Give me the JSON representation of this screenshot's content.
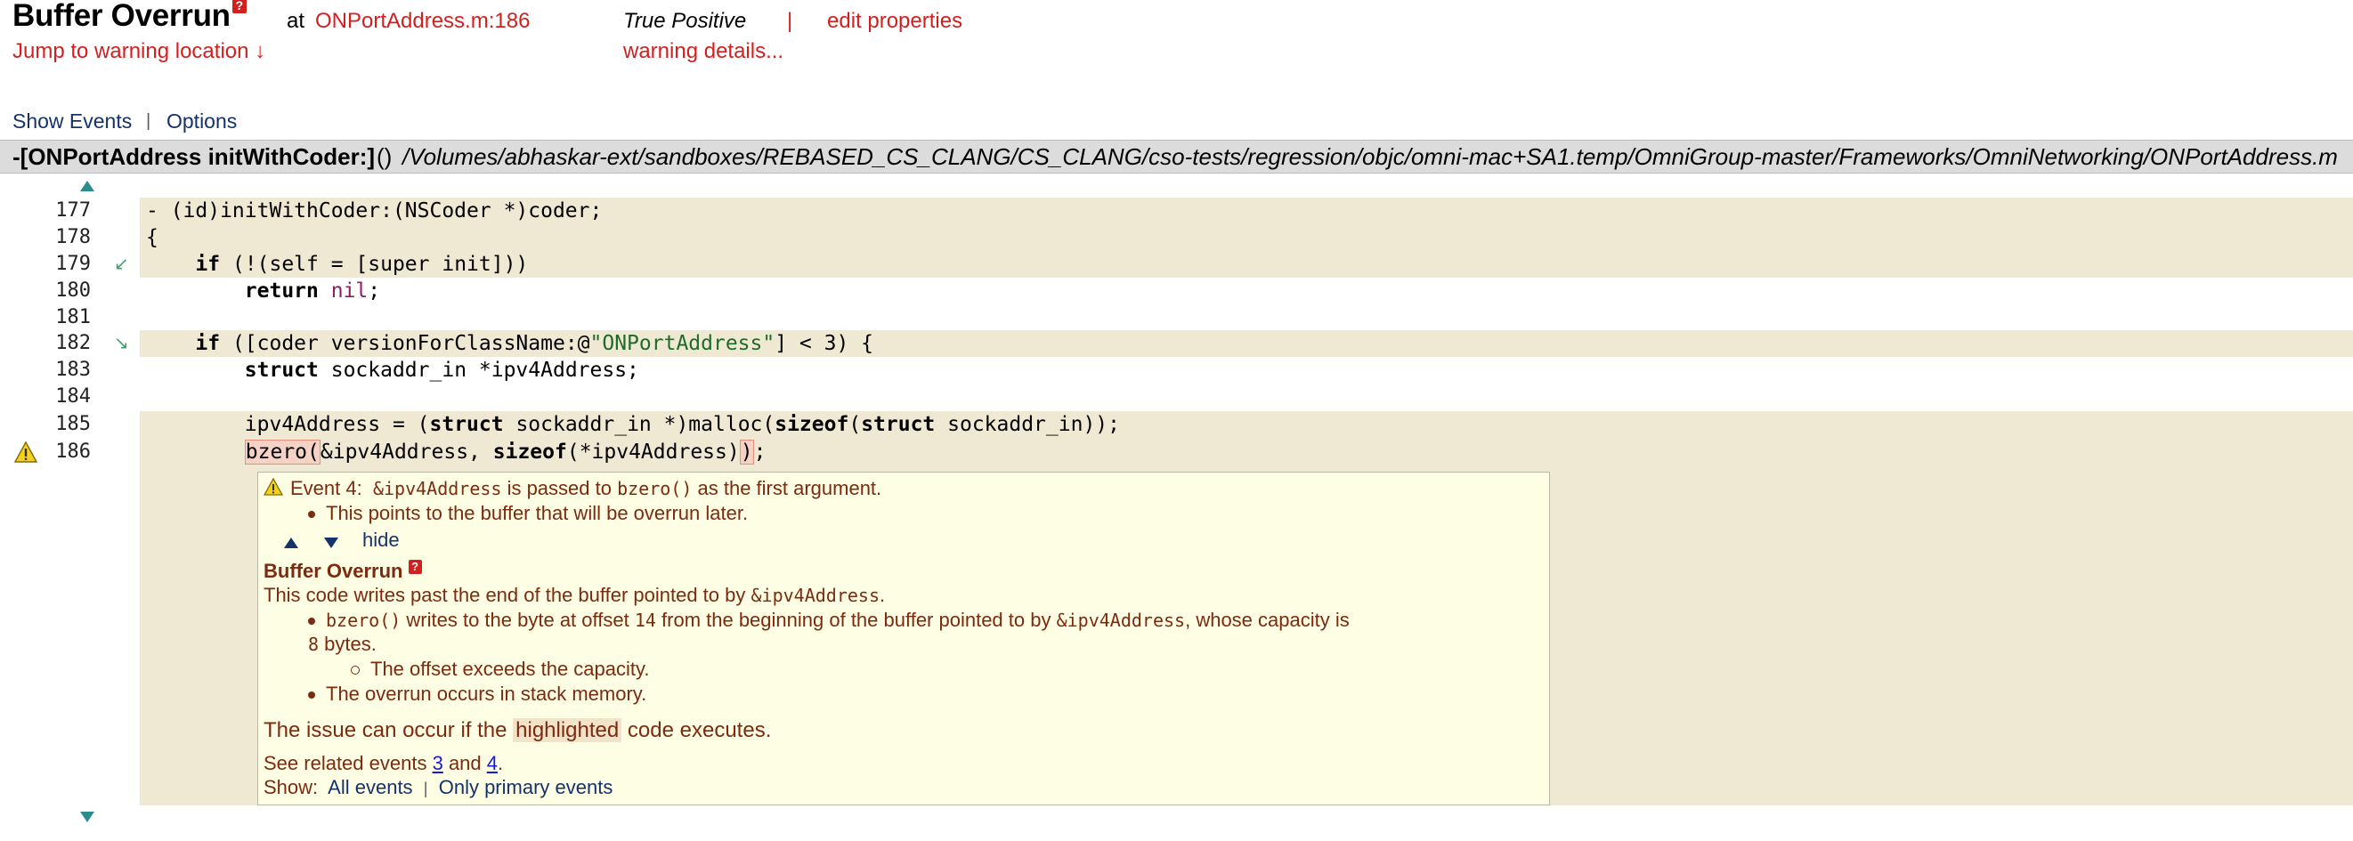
{
  "header": {
    "title": "Buffer Overrun",
    "help_glyph": "?",
    "at_word": "at",
    "location_link": "ONPortAddress.m:186",
    "jump_link": "Jump to warning location ↓",
    "status": "True Positive",
    "separator": "|",
    "edit_link": "edit properties",
    "details_link": "warning details..."
  },
  "toolbar": {
    "show_events": "Show Events",
    "separator": "|",
    "options": "Options"
  },
  "pathbar": {
    "function": "-[ONPortAddress initWithCoder:]",
    "parens": "()",
    "file_path": "/Volumes/abhaskar-ext/sandboxes/REBASED_CS_CLANG/CS_CLANG/cso-tests/regression/objc/omni-mac+SA1.temp/OmniGroup-master/Frameworks/OmniNetworking/ONPortAddress.m"
  },
  "code": {
    "lines": [
      {
        "num": "177"
      },
      {
        "num": "178"
      },
      {
        "num": "179"
      },
      {
        "num": "180"
      },
      {
        "num": "181"
      },
      {
        "num": "182"
      },
      {
        "num": "183"
      },
      {
        "num": "184"
      },
      {
        "num": "185"
      },
      {
        "num": "186"
      }
    ],
    "scroll_up_icon": "triangle-up",
    "scroll_down_icon": "triangle-down"
  },
  "event": {
    "prefix": "Event 4:",
    "arg_code": "&ipv4Address",
    "middle": " is passed to ",
    "fn_code": "bzero()",
    "suffix": " as the first argument.",
    "bullet": "This points to the buffer that will be overrun later.",
    "hide": "hide",
    "heading": "Buffer Overrun",
    "help_glyph": "?",
    "desc_text": "This code writes past the end of the buffer pointed to by ",
    "desc_code": "&ipv4Address",
    "desc_end": ".",
    "b1_fn": "bzero()",
    "b1_a": " writes to the byte at offset ",
    "b1_offset": "14",
    "b1_b": " from the beginning of the buffer pointed to by ",
    "b1_code": "&ipv4Address",
    "b1_c": ", whose capacity is",
    "b1_capacity": "8",
    "b1_d": " bytes.",
    "sub_bullet": "The offset exceeds the capacity.",
    "b2": "The overrun occurs in stack memory.",
    "issue_a": "The issue can occur if the ",
    "issue_hl": "highlighted",
    "issue_b": " code executes.",
    "related_a": "See related events ",
    "related_1": "3",
    "related_and": " and ",
    "related_2": "4",
    "related_end": ".",
    "show_label": "Show:",
    "all_events": "All events",
    "separator": "|",
    "primary_events": "Only primary events"
  },
  "colors": {
    "accent_red": "#d41f1f",
    "link_navy": "#16326a",
    "code_band": "#efe9d3",
    "event_box_bg": "#fefee5",
    "event_text": "#7c2a10"
  }
}
